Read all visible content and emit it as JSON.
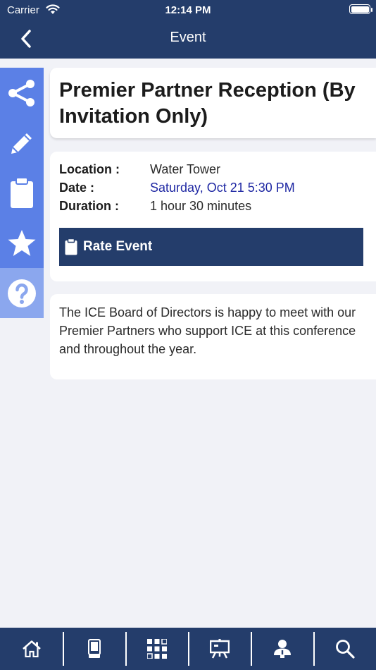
{
  "status_bar": {
    "carrier": "Carrier",
    "time": "12:14 PM"
  },
  "nav": {
    "title": "Event",
    "back_icon": "chevron-left-icon"
  },
  "side_actions": [
    {
      "name": "share",
      "icon": "share-icon"
    },
    {
      "name": "note",
      "icon": "pencil-icon"
    },
    {
      "name": "clipboard",
      "icon": "clipboard-icon"
    },
    {
      "name": "favorite",
      "icon": "star-icon"
    },
    {
      "name": "help",
      "icon": "help-icon"
    }
  ],
  "event": {
    "title": "Premier Partner Reception (By Invitation Only)",
    "location_label": "Location :",
    "location": "Water Tower",
    "date_label": "Date :",
    "date": "Saturday, Oct 21 5:30 PM",
    "duration_label": "Duration :",
    "duration": "1 hour 30 minutes",
    "rate_label": "Rate Event",
    "description": "The ICE Board of Directors is happy to meet with our Premier Partners who support ICE at this conference and throughout the year."
  },
  "tabbar": [
    {
      "name": "home",
      "icon": "home-icon"
    },
    {
      "name": "exhibitors",
      "icon": "kiosk-icon"
    },
    {
      "name": "floorplan",
      "icon": "grid-icon"
    },
    {
      "name": "presentations",
      "icon": "easel-icon"
    },
    {
      "name": "attendees",
      "icon": "person-icon"
    },
    {
      "name": "search",
      "icon": "search-icon"
    }
  ],
  "colors": {
    "nav_bg": "#243d6b",
    "rail_bg": "#5b80e6",
    "rail_active": "#8ba7ee",
    "date_text": "#1f28a3",
    "page_bg": "#f1f2f7"
  }
}
